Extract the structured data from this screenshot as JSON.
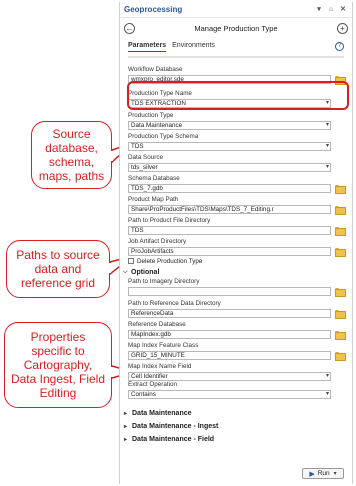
{
  "callouts": {
    "source": "Source\ndatabase,\nschema,\nmaps, paths",
    "paths": "Paths to source\ndata and\nreference grid",
    "props": "Properties\nspecific to\nCartography,\nData Ingest, Field\nEditing"
  },
  "pane": {
    "title": "Geoprocessing",
    "controls": {
      "pin": "▾",
      "autohide": "⌂",
      "close": "✕"
    },
    "back_icon": "←",
    "tool_name": "Manage Production Type",
    "add_icon": "+",
    "tabs": [
      "Parameters",
      "Environments"
    ],
    "help_icon": "?"
  },
  "fields": {
    "workflow_db": {
      "label": "Workflow Database",
      "value": "wmxpro_editor.sde"
    },
    "ptype_name": {
      "label": "Production Type Name",
      "value": "TDS EXTRACTION"
    },
    "ptype": {
      "label": "Production Type",
      "value": "Data Maintenance"
    },
    "schema": {
      "label": "Production Type Schema",
      "value": "TDS"
    },
    "data_source": {
      "label": "Data Source",
      "value": "tds_silver"
    },
    "schema_db": {
      "label": "Schema Database",
      "value": "TDS_7.gdb"
    },
    "map_path": {
      "label": "Product Map Path",
      "value": "Share\\ProProductFiles\\TDS\\Maps\\TDS_7_Editing.r"
    },
    "file_dir": {
      "label": "Path to Product File Directory",
      "value": "TDS"
    },
    "job_db": {
      "label": "Job Artifact Directory",
      "value": "ProJobArtifacts"
    },
    "delete_label": "Delete Production Type",
    "optional_label": "Optional",
    "imagery_dir": {
      "label": "Path to Imagery Directory",
      "value": ""
    },
    "ref_data_dir": {
      "label": "Path to Reference Data Directory",
      "value": "ReferenceData"
    },
    "ref_db": {
      "label": "Reference Database",
      "value": "MapIndex.gdb"
    },
    "map_index_fc": {
      "label": "Map Index Feature Class",
      "value": "GRID_15_MINUTE"
    },
    "map_index_name": {
      "label": "Map Index Name Field",
      "value": "Cell Identifier"
    },
    "extract_op": {
      "label": "Extract Operation",
      "value": "Contains"
    }
  },
  "groups": [
    "Data Maintenance",
    "Data Maintenance - Ingest",
    "Data Maintenance - Field"
  ],
  "run": {
    "label": "Run"
  },
  "colors": {
    "accent": "#2b5797",
    "callout": "#d62020",
    "folder": "#f1c24b"
  }
}
